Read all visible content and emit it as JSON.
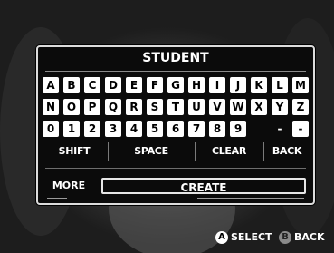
{
  "screen_title": "STUDENT",
  "keys": {
    "row1": [
      "A",
      "B",
      "C",
      "D",
      "E",
      "F",
      "G",
      "H",
      "I",
      "J",
      "K",
      "L",
      "M"
    ],
    "row2": [
      "N",
      "O",
      "P",
      "Q",
      "R",
      "S",
      "T",
      "U",
      "V",
      "W",
      "X",
      "Y",
      "Z"
    ],
    "row3": [
      "0",
      "1",
      "2",
      "3",
      "4",
      "5",
      "6",
      "7",
      "8",
      "9",
      "",
      "-",
      "-"
    ]
  },
  "actions": {
    "shift": "SHIFT",
    "space": "SPACE",
    "clear": "CLEAR",
    "back": "BACK",
    "more": "MORE",
    "create": "CREATE"
  },
  "prompts": {
    "a_glyph": "A",
    "select": "SELECT",
    "b_glyph": "B",
    "back": "BACK"
  }
}
